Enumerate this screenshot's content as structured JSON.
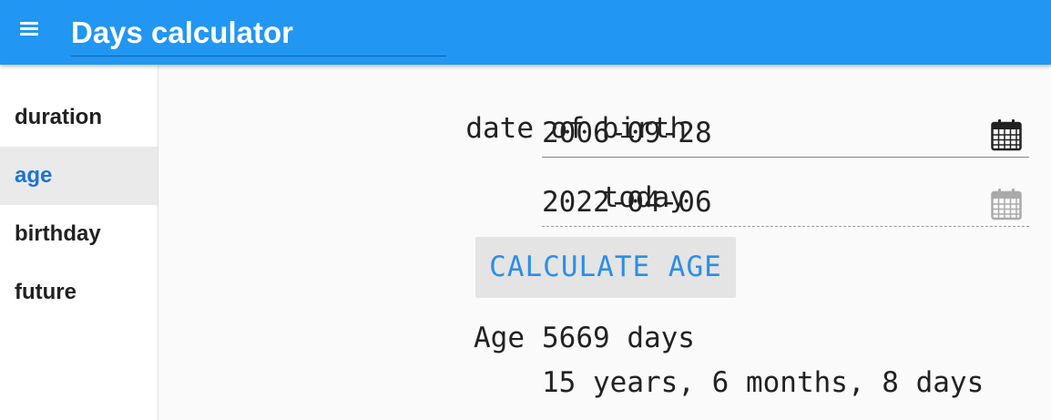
{
  "header": {
    "title": "Days calculator"
  },
  "sidebar": {
    "items": [
      {
        "label": "duration",
        "active": false
      },
      {
        "label": "age",
        "active": true
      },
      {
        "label": "birthday",
        "active": false
      },
      {
        "label": "future",
        "active": false
      }
    ]
  },
  "form": {
    "dob_label": "date of birth",
    "dob_value": "2006-09-28",
    "today_label": "today",
    "today_value": "2022-04-06",
    "button_label": "CALCULATE AGE"
  },
  "result": {
    "label": "Age",
    "days": "5669 days",
    "breakdown": "15 years, 6 months, 8 days"
  },
  "colors": {
    "appbar": "#2196f3",
    "accent": "#1e73d6",
    "button_text": "#2b8ee8"
  },
  "icons": {
    "menu": "hamburger-menu-icon",
    "calendar": "calendar-icon"
  }
}
